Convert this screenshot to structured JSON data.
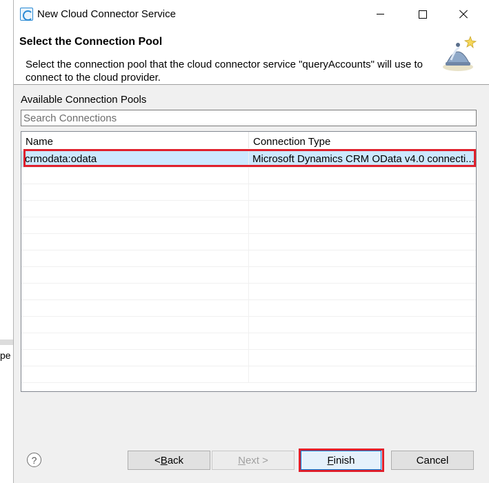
{
  "window": {
    "title": "New Cloud Connector Service"
  },
  "banner": {
    "title": "Select the Connection Pool",
    "description": "Select the connection pool that the cloud connector service \"queryAccounts\" will use to connect to the cloud provider."
  },
  "pools": {
    "label": "Available Connection Pools",
    "search_placeholder": "Search Connections",
    "columns": [
      "Name",
      "Connection Type"
    ],
    "rows": [
      {
        "name": "crmodata:odata",
        "type": "Microsoft Dynamics CRM OData v4.0 connecti..."
      }
    ]
  },
  "buttons": {
    "help": "?",
    "back_prefix": "< ",
    "back_mnemonic": "B",
    "back_rest": "ack",
    "next_mnemonic": "N",
    "next_rest": "ext >",
    "finish_mnemonic": "F",
    "finish_rest": "inish",
    "cancel": "Cancel"
  },
  "background": {
    "fragment": "pe"
  },
  "colors": {
    "highlight": "#e0202c",
    "selection": "#cce8ff",
    "accent": "#0078d7"
  }
}
